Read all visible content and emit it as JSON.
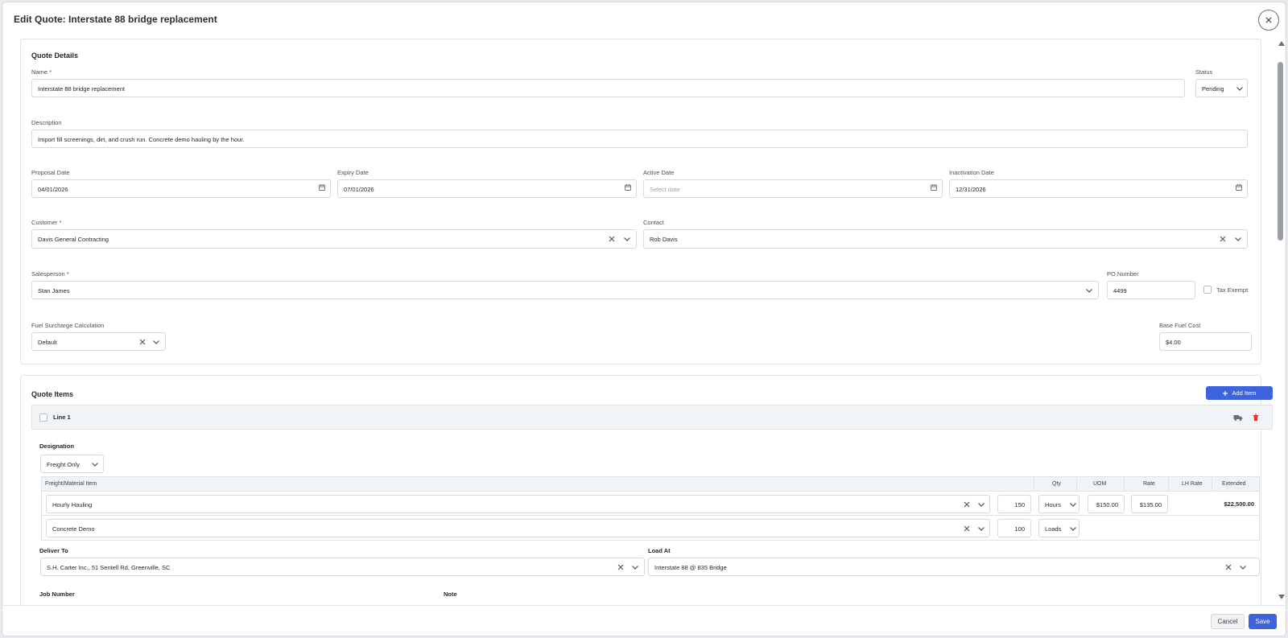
{
  "modal": {
    "title": "Edit Quote: Interstate 88 bridge replacement"
  },
  "details": {
    "title": "Quote Details",
    "name_label": "Name *",
    "name_value": "Interstate 88 bridge replacement",
    "status_label": "Status",
    "status_value": "Pending",
    "description_label": "Description",
    "description_value": "Import fill screenings, dirt, and crush run. Concrete demo hauling by the hour.",
    "proposal_date_label": "Proposal Date",
    "proposal_date_value": "04/01/2026",
    "expiry_date_label": "Expiry Date",
    "expiry_date_value": "07/01/2026",
    "active_date_label": "Active Date",
    "active_date_placeholder": "Select date",
    "inactivation_date_label": "Inactivation Date",
    "inactivation_date_value": "12/31/2026",
    "customer_label": "Customer *",
    "customer_value": "Davis General Contracting",
    "contact_label": "Contact",
    "contact_value": "Rob Davis",
    "salesperson_label": "Salesperson *",
    "salesperson_value": "Stan James",
    "po_label": "PO Number",
    "po_value": "4499",
    "tax_exempt_label": "Tax Exempt",
    "fuel_label": "Fuel Surcharge Calculation",
    "fuel_value": "Default",
    "base_fuel_label": "Base Fuel Cost",
    "base_fuel_value": "$4.00"
  },
  "items": {
    "title": "Quote Items",
    "add_label": "Add Item",
    "line_title": "Line 1",
    "designation_label": "Designation",
    "designation_value": "Freight Only",
    "columns": {
      "item": "Freight/Material Item",
      "qty": "Qty",
      "uom": "UOM",
      "rate": "Rate",
      "lh_rate": "LH Rate",
      "extended": "Extended"
    },
    "rows": [
      {
        "item": "Hourly Hauling",
        "qty": "150",
        "uom": "Hours",
        "rate": "$150.00",
        "lh_rate": "$135.00",
        "extended": "$22,500.00"
      },
      {
        "item": "Concrete Demo",
        "qty": "100",
        "uom": "Loads"
      }
    ],
    "deliver_to_label": "Deliver To",
    "deliver_to_value": "S.H. Carter Inc., 51 Sentell Rd, Greenville, SC",
    "load_at_label": "Load At",
    "load_at_value": "Interstate 88 @ 835 Bridge",
    "job_number_label": "Job Number",
    "note_label": "Note"
  },
  "footer": {
    "cancel_label": "Cancel",
    "save_label": "Save"
  },
  "colors": {
    "primary": "#3d63dd",
    "danger": "#d93434",
    "border": "#d5d8dd",
    "header_bg": "#f1f4f7"
  },
  "icons": [
    "close-icon",
    "chevron-down-icon",
    "calendar-icon",
    "clear-icon",
    "plus-icon",
    "truck-icon",
    "trash-icon"
  ]
}
